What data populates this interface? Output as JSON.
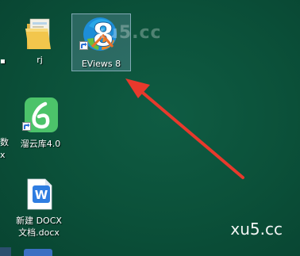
{
  "desktop": {
    "background_color": "#0b5039",
    "icons": [
      {
        "label": "rj"
      },
      {
        "label": "EViews 8"
      },
      {
        "label": "溜云库4.0"
      },
      {
        "label_line1": "新建 DOCX",
        "label_line2": "文档.docx"
      }
    ],
    "edge_text": {
      "left_line1": "数",
      "left_line2": "x"
    }
  },
  "overlay": {
    "watermark": "xu5.cc",
    "corner_text": "xu5.cc",
    "arrow_color": "#e8392c"
  }
}
